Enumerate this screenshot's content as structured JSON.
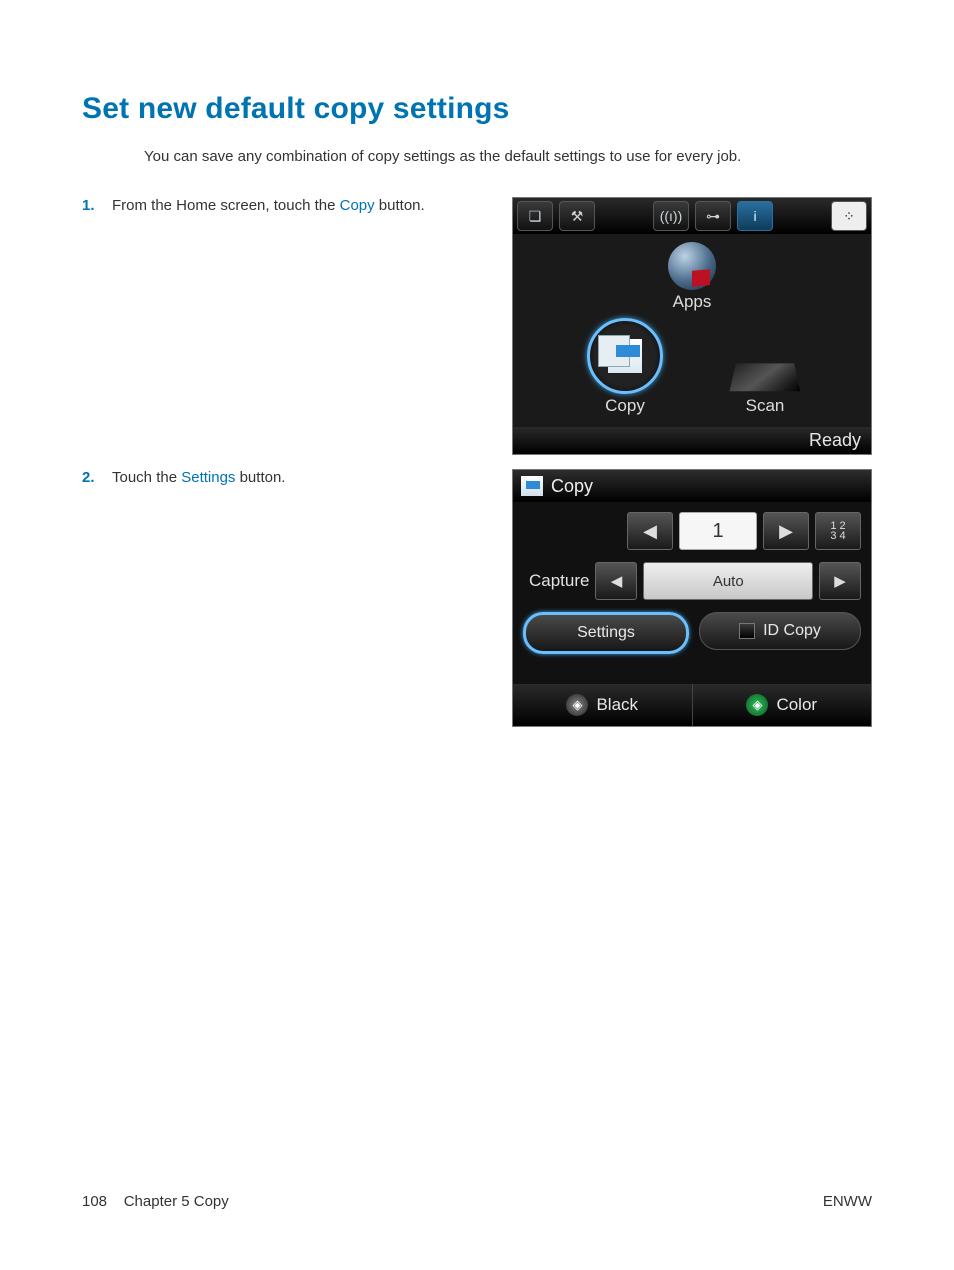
{
  "heading": "Set new default copy settings",
  "intro": "You can save any combination of copy settings as the default settings to use for every job.",
  "steps": [
    {
      "num": "1.",
      "pre": "From the Home screen, touch the ",
      "hl": "Copy",
      "post": " button."
    },
    {
      "num": "2.",
      "pre": "Touch the ",
      "hl": "Settings",
      "post": " button."
    }
  ],
  "home": {
    "apps": "Apps",
    "copy": "Copy",
    "scan": "Scan",
    "ready": "Ready",
    "icons": {
      "doc": "❏",
      "tools": "⚒",
      "wifi": "((ı))",
      "net": "⊶",
      "info": "i",
      "dice": "⁘"
    }
  },
  "copyscreen": {
    "title": "Copy",
    "copies": "1",
    "left": "◀",
    "right": "▶",
    "grid": "1 2\n3 4",
    "captureLabel": "Capture",
    "auto": "Auto",
    "settings": "Settings",
    "idcopy": "ID Copy",
    "black": "Black",
    "color": "Color",
    "go": "◈"
  },
  "footer": {
    "page": "108",
    "chapter": "Chapter 5   Copy",
    "lang": "ENWW"
  }
}
